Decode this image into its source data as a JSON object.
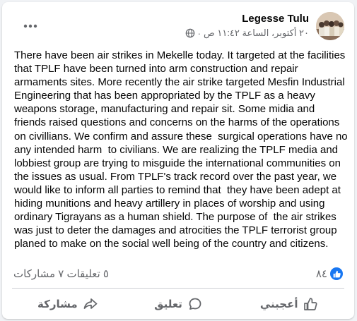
{
  "post": {
    "author": "Legesse Tulu",
    "timestamp": "٢٠ أكتوبر، الساعة ١١:٤٢ ص",
    "separator": "·",
    "privacy_icon": "globe-icon",
    "more_icon": "more-horizontal-icon",
    "text": "There have been air strikes in Mekelle today. It targeted at the facilities that TPLF have been turned into arm construction and repair armaments sites. More recently the air strike targeted Mesfin Industrial Engineering that has been appropriated by the TPLF as a heavy weapons storage, manufacturing and repair sit. Some midia and friends raised questions and concerns on the harms of the operations on civillians. We confirm and assure these  surgical operations have no any intended harm  to civilians. We are realizing the TPLF media and lobbiest group are trying to misguide the international communities on the issues as usual. From TPLF's track record over the past year, we would like to inform all parties to remind that  they have been adept at hiding munitions and heavy artillery in places of worship and using ordinary Tigrayans as a human shield. The purpose of  the air strikes was just to deter the damages and atrocities the TPLF terrorist group planed to make on the social well being of the country and citizens."
  },
  "stats": {
    "comments_shares": "٥ تعليقات ٧ مشاركات",
    "reactions_count": "٨٤",
    "reaction_icon": "like-icon"
  },
  "actions": {
    "like_label": "أعجبني",
    "comment_label": "تعليق",
    "share_label": "مشاركة"
  },
  "colors": {
    "accent": "#1877f2",
    "secondary_text": "#65676b",
    "primary_text": "#050505"
  }
}
